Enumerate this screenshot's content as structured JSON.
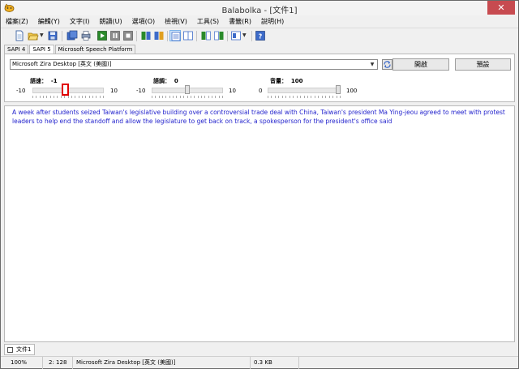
{
  "window": {
    "title": "Balabolka - [文件1]",
    "close_glyph": "✕"
  },
  "menu": {
    "items": [
      "檔案(Z)",
      "編輯(Y)",
      "文字(I)",
      "朗讀(U)",
      "選項(O)",
      "檢視(V)",
      "工具(S)",
      "書籤(R)",
      "說明(H)"
    ]
  },
  "toolbar": {
    "icons": [
      "new-file-icon",
      "open-folder-icon",
      "save-icon",
      "batch-icon",
      "print-icon",
      "play-icon",
      "pause-icon",
      "stop-icon",
      "prev-bookmark-icon",
      "next-bookmark-icon",
      "text-view-icon",
      "split-view-icon",
      "spell-icon",
      "clipboard-icon",
      "voice-settings-icon",
      "help-icon"
    ],
    "accent": "#2a8a2a"
  },
  "engine_tabs": [
    "SAPI 4",
    "SAPI 5",
    "Microsoft Speech Platform"
  ],
  "engine_tab_active": "SAPI 5",
  "voice": {
    "selected": "Microsoft Zira Desktop [英文 (美國)]",
    "open_label": "開啟",
    "defaults_label": "預設"
  },
  "sliders": {
    "rate": {
      "label": "語速：",
      "value": "-1",
      "min": "-10",
      "max": "10",
      "level": 0.45
    },
    "pitch": {
      "label": "語調：",
      "value": "0",
      "min": "-10",
      "max": "10",
      "level": 0.5
    },
    "volume": {
      "label": "音量：",
      "value": "100",
      "min": "0",
      "max": "100",
      "level": 1.0
    }
  },
  "editor": {
    "text": "A week after students seized Taiwan's legislative building over a controversial trade deal with China, Taiwan's president Ma Ying-jeou agreed to meet with protest leaders to help end the standoff and allow the legislature to get back on track, a spokesperson for the president's office said",
    "text_color": "#1f1fcc"
  },
  "doc_tabs": [
    "文件1"
  ],
  "status": {
    "zoom": "100%",
    "position": "2: 128",
    "voice": "Microsoft Zira Desktop [英文 (美國)]",
    "size": "0.3 KB"
  },
  "colors": {
    "close_button": "#c74b50",
    "focus_outline": "#e00000"
  }
}
